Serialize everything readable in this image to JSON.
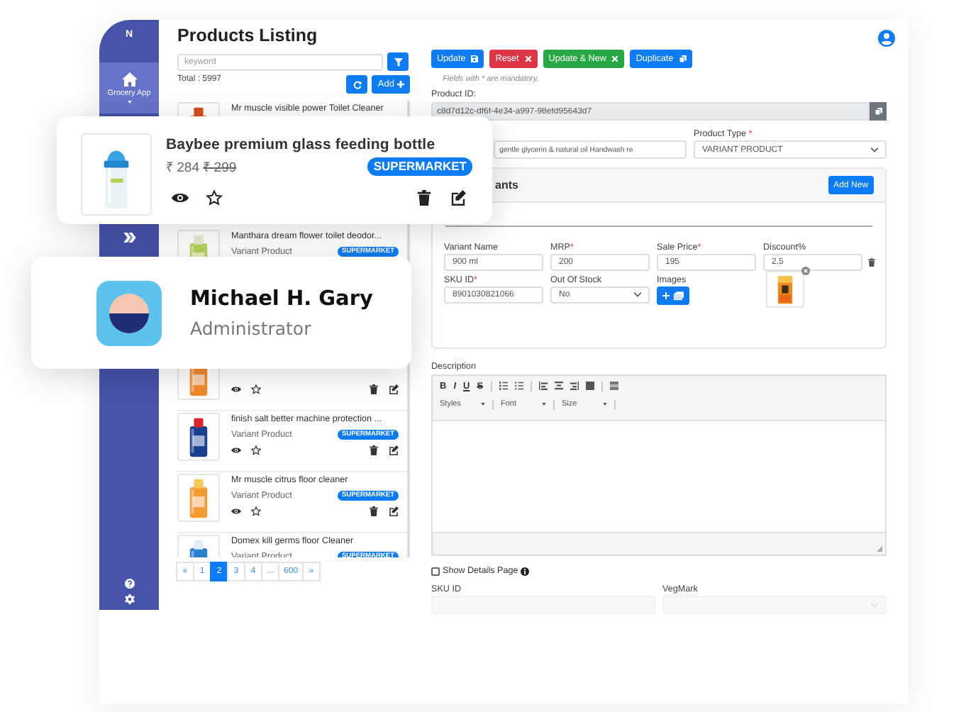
{
  "sidebar": {
    "logo": "N",
    "items": [
      {
        "label": "Grocery App",
        "selected": true
      }
    ]
  },
  "listing": {
    "title": "Products Listing",
    "search": {
      "placeholder": "keyword"
    },
    "total": "Total : 5997",
    "add_label": "Add",
    "items": [
      {
        "name": "Mr muscle visible power Toilet Cleaner"
      },
      {
        "name": "Manthara dream flower toilet deodor...",
        "type": "Variant Product",
        "badge": "SUPERMARKET"
      },
      {
        "actions": true
      },
      {
        "name": "finish salt better machine protection ...",
        "type": "Variant Product",
        "badge": "SUPERMARKET",
        "actions": true
      },
      {
        "name": "Mr muscle citrus floor cleaner",
        "type": "Variant Product",
        "badge": "SUPERMARKET",
        "actions": true
      },
      {
        "name": "Domex kill germs floor Cleaner",
        "type": "Variant Product",
        "badge": "SUPERMARKET"
      }
    ],
    "pagination": [
      {
        "label": "«",
        "selected": false
      },
      {
        "label": "1",
        "selected": false
      },
      {
        "label": "2",
        "selected": true
      },
      {
        "label": "3",
        "selected": false
      },
      {
        "label": "4",
        "selected": false
      },
      {
        "label": "...",
        "selected": false
      },
      {
        "label": "600",
        "selected": false
      },
      {
        "label": "»",
        "selected": false
      }
    ]
  },
  "featured_product": {
    "name": "Baybee premium glass feeding bottle",
    "price": "₹ 284",
    "old_price": "₹ 299",
    "badge": "SUPERMARKET"
  },
  "user_card": {
    "name": "Michael H. Gary",
    "role": "Administrator"
  },
  "actions": [
    {
      "label": "Update",
      "kind": "save"
    },
    {
      "label": "Reset",
      "kind": "reset"
    },
    {
      "label": "Update & New",
      "kind": "save_new"
    },
    {
      "label": "Duplicate",
      "kind": "duplicate"
    }
  ],
  "form": {
    "note": "Fields with * are mandatory.",
    "product_id": {
      "label": "Product ID:",
      "value": "c8d7d12c-df6f-4e34-a997-98efd95643d7"
    },
    "product_name": {
      "value": "gentle glycerin & natural oil Handwash re"
    },
    "product_type": {
      "label": "Product Type",
      "mark": "*",
      "value": "VARIANT PRODUCT"
    },
    "variants": {
      "title": "ants",
      "add_label": "Add New",
      "rows": [
        {
          "removable": true,
          "fields": [
            {
              "label": "Variant Name",
              "value": "900 ml",
              "kind": "input"
            },
            {
              "label": "MRP",
              "mark": "*",
              "value": "200",
              "kind": "input"
            },
            {
              "label": "Sale Price",
              "mark": "*",
              "value": "195",
              "kind": "input"
            },
            {
              "label": "Discount%",
              "value": "2.5",
              "kind": "input"
            }
          ]
        },
        {
          "removable": false,
          "fields": [
            {
              "label": "SKU ID",
              "mark": "*",
              "value": "8901030821066",
              "kind": "input"
            },
            {
              "label": "Out Of Stock",
              "value": "No",
              "kind": "select"
            },
            {
              "label": "Images",
              "kind": "upload"
            },
            {
              "kind": "thumbnail"
            }
          ]
        }
      ]
    },
    "description": {
      "label": "Description",
      "format_buttons": [
        "B",
        "I",
        "U",
        "S"
      ],
      "dropdowns": [
        "Styles",
        "Font",
        "Size"
      ]
    },
    "show_details": {
      "label": "Show Details Page",
      "checked": false
    },
    "bottom_fields": [
      {
        "label": "SKU ID",
        "kind": "input"
      },
      {
        "label": "VegMark",
        "kind": "select"
      }
    ]
  }
}
